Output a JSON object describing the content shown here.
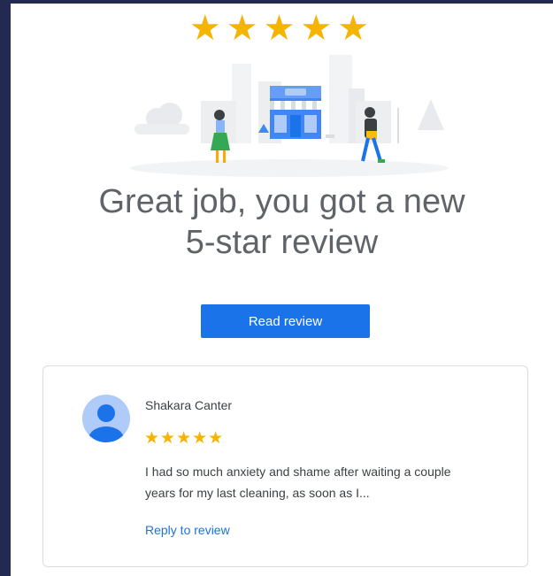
{
  "header": {
    "rating_stars": "★★★★★"
  },
  "main": {
    "headline_line1": "Great job, you got a new",
    "headline_line2": "5-star review",
    "read_review_label": "Read review"
  },
  "review": {
    "reviewer_name": "Shakara Canter",
    "stars": "★★★★★",
    "text_line1": "I had so much anxiety and shame after waiting a couple",
    "text_line2": "years for my last cleaning, as soon as I...",
    "reply_label": "Reply to review"
  },
  "colors": {
    "page_background": "#232a52",
    "card_background": "#ffffff",
    "star_color": "#f5b400",
    "button_color": "#1a73e8",
    "link_color": "#1a73e8",
    "avatar_color": "#aecbfa"
  },
  "icons": {
    "avatar": "person-avatar-icon",
    "illustration": "storefront-illustration"
  }
}
